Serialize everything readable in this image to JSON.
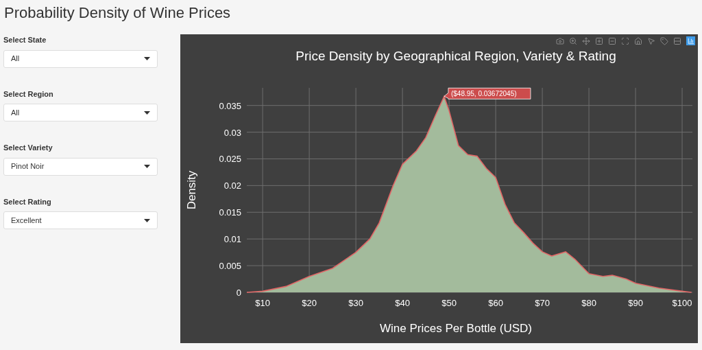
{
  "page_title": "Probability Density of Wine Prices",
  "filters": [
    {
      "label": "Select State",
      "value": "All"
    },
    {
      "label": "Select Region",
      "value": "All"
    },
    {
      "label": "Select Variety",
      "value": "Pinot Noir"
    },
    {
      "label": "Select Rating",
      "value": "Excellent"
    }
  ],
  "chart": {
    "chart_data": {
      "type": "area",
      "title": "Price Density by Geographical Region, Variety & Rating",
      "xlabel": "Wine Prices Per Bottle (USD)",
      "ylabel": "Density",
      "x": [
        6.6,
        10,
        15,
        20,
        25,
        30,
        33,
        35,
        38,
        40,
        43,
        45,
        47,
        48.95,
        50,
        52,
        54,
        56,
        58,
        60,
        62,
        64,
        66,
        68,
        70,
        72,
        75,
        77,
        80,
        83,
        85,
        88,
        90,
        95,
        100,
        102
      ],
      "grid": true,
      "series": [
        {
          "color": "#e06666",
          "values": [
            0,
            0.0002,
            0.0011,
            0.003,
            0.0045,
            0.0075,
            0.01,
            0.013,
            0.02,
            0.024,
            0.0265,
            0.029,
            0.033,
            0.0367,
            0.034,
            0.0275,
            0.0258,
            0.0255,
            0.0232,
            0.0215,
            0.0165,
            0.013,
            0.0112,
            0.0092,
            0.0076,
            0.0068,
            0.0076,
            0.0062,
            0.0035,
            0.003,
            0.0032,
            0.0025,
            0.0017,
            0.0008,
            0.0002,
            0
          ]
        }
      ],
      "xlim": [
        6.6,
        102.2
      ],
      "ylim": [
        0,
        0.0383
      ],
      "xticks": [
        {
          "value": 10,
          "label": "$10"
        },
        {
          "value": 20,
          "label": "$20"
        },
        {
          "value": 30,
          "label": "$30"
        },
        {
          "value": 40,
          "label": "$40"
        },
        {
          "value": 50,
          "label": "$50"
        },
        {
          "value": 60,
          "label": "$60"
        },
        {
          "value": 70,
          "label": "$70"
        },
        {
          "value": 80,
          "label": "$80"
        },
        {
          "value": 90,
          "label": "$90"
        },
        {
          "value": 100,
          "label": "$100"
        }
      ],
      "yticks": [
        {
          "value": 0,
          "label": "0"
        },
        {
          "value": 0.005,
          "label": "0.005"
        },
        {
          "value": 0.01,
          "label": "0.01"
        },
        {
          "value": 0.015,
          "label": "0.015"
        },
        {
          "value": 0.02,
          "label": "0.02"
        },
        {
          "value": 0.025,
          "label": "0.025"
        },
        {
          "value": 0.03,
          "label": "0.03"
        },
        {
          "value": 0.035,
          "label": "0.035"
        }
      ],
      "annotations": [
        {
          "x": 48.95,
          "y": 0.03672045,
          "text": "($48.95, 0.03672045)"
        }
      ]
    }
  }
}
